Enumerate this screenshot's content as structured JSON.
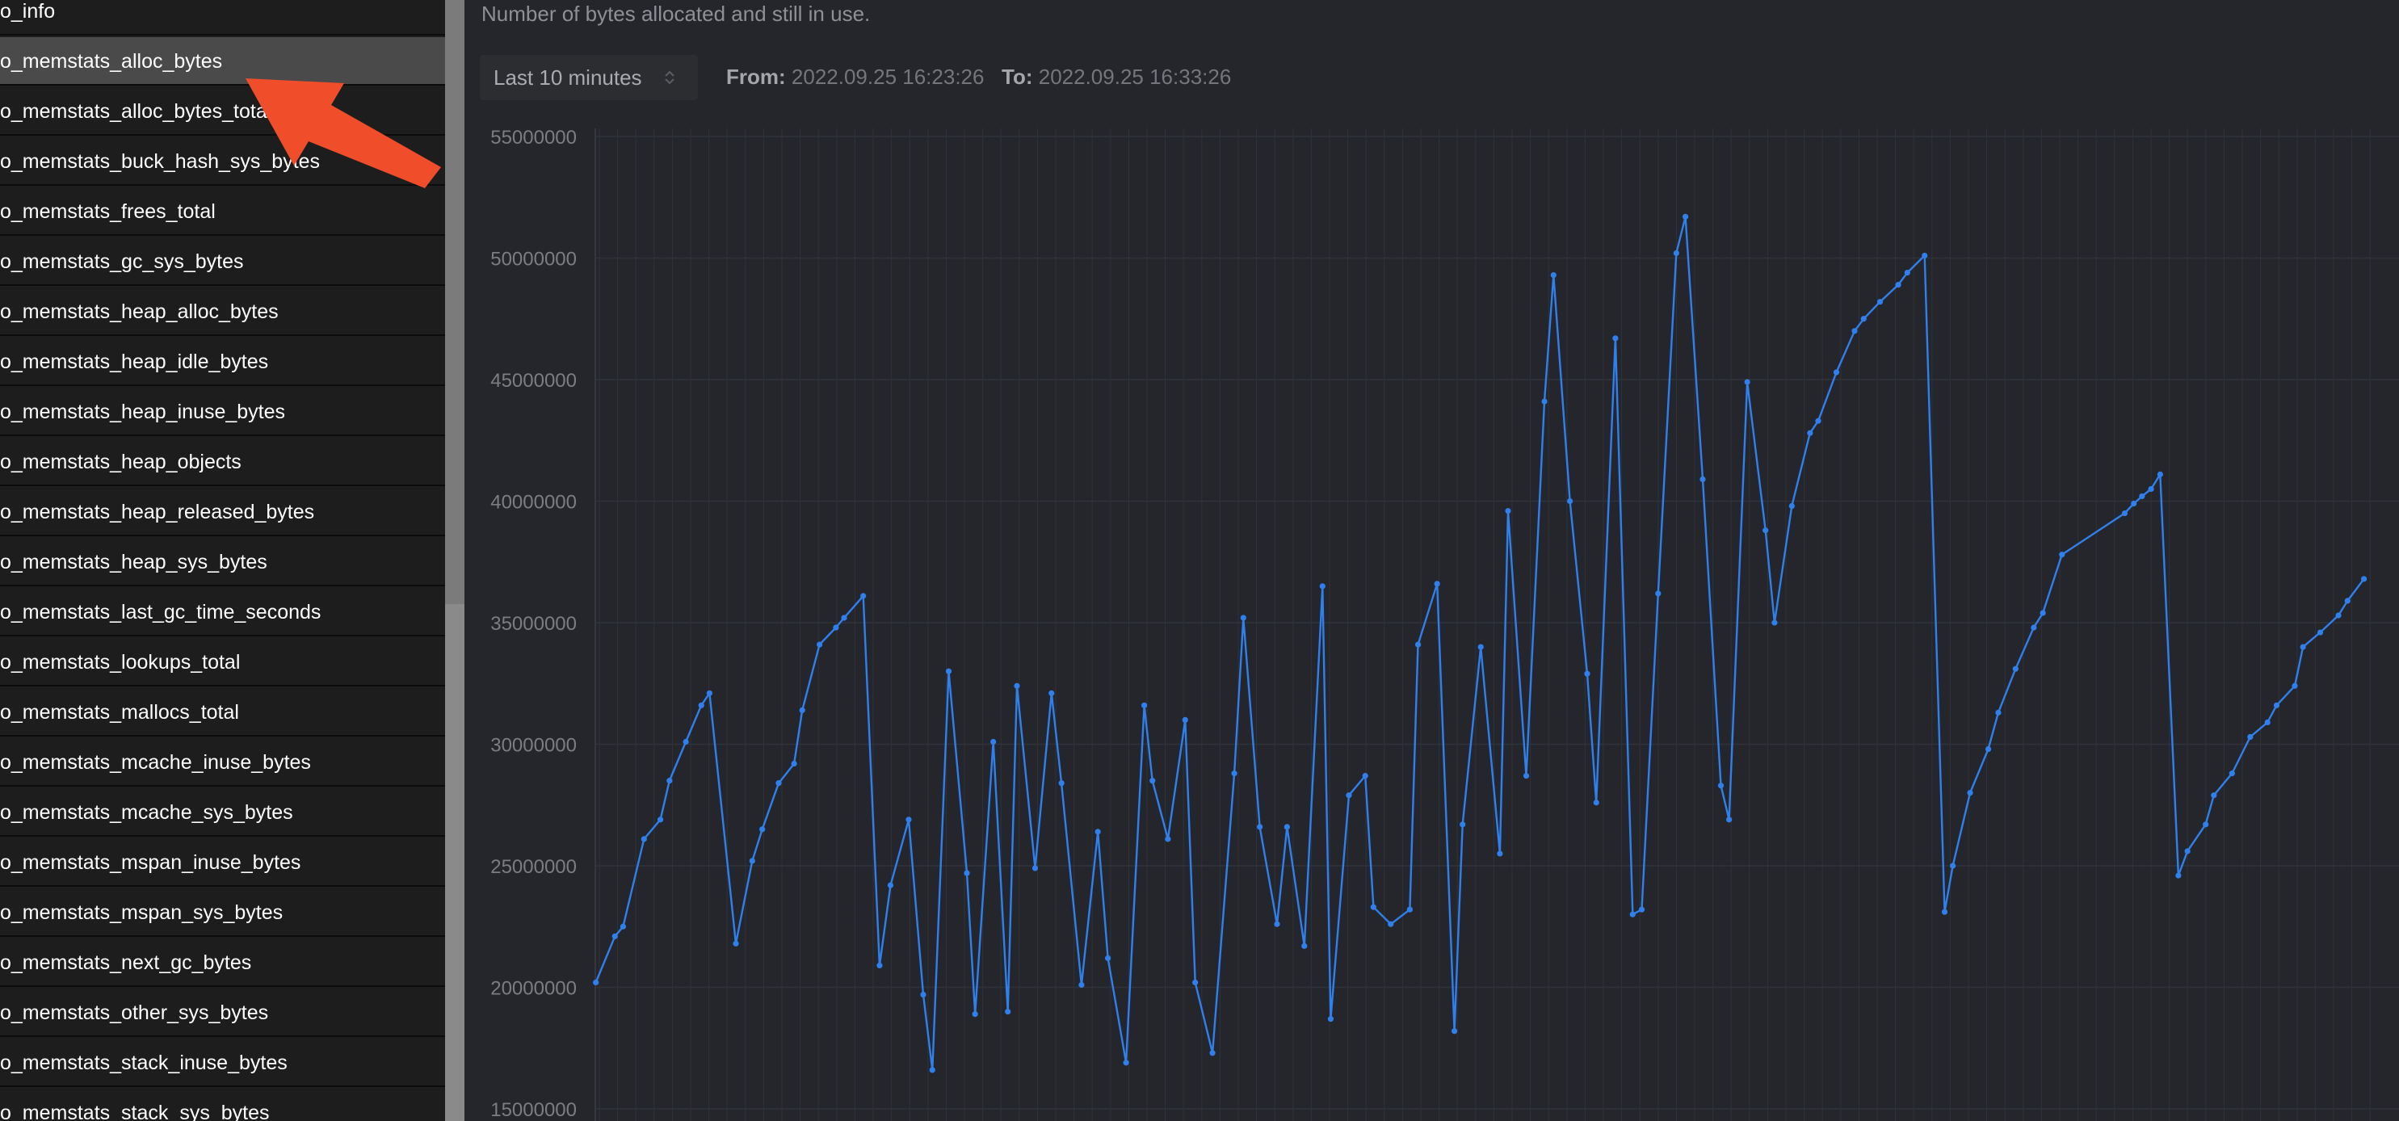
{
  "sidebar": {
    "selected_index": 1,
    "items": [
      "o_info",
      "o_memstats_alloc_bytes",
      "o_memstats_alloc_bytes_total",
      "o_memstats_buck_hash_sys_bytes",
      "o_memstats_frees_total",
      "o_memstats_gc_sys_bytes",
      "o_memstats_heap_alloc_bytes",
      "o_memstats_heap_idle_bytes",
      "o_memstats_heap_inuse_bytes",
      "o_memstats_heap_objects",
      "o_memstats_heap_released_bytes",
      "o_memstats_heap_sys_bytes",
      "o_memstats_last_gc_time_seconds",
      "o_memstats_lookups_total",
      "o_memstats_mallocs_total",
      "o_memstats_mcache_inuse_bytes",
      "o_memstats_mcache_sys_bytes",
      "o_memstats_mspan_inuse_bytes",
      "o_memstats_mspan_sys_bytes",
      "o_memstats_next_gc_bytes",
      "o_memstats_other_sys_bytes",
      "o_memstats_stack_inuse_bytes",
      "o_memstats_stack_sys_bytes"
    ]
  },
  "main": {
    "description": "Number of bytes allocated and still in use.",
    "range": {
      "selected": "Last 10 minutes"
    },
    "from": {
      "label": "From:",
      "value": "2022.09.25 16:23:26"
    },
    "to": {
      "label": "To:",
      "value": "2022.09.25 16:33:26"
    }
  },
  "colors": {
    "series": "#2f80ed",
    "annotation_arrow": "#f04e2a",
    "grid": "#30333a"
  },
  "chart_data": {
    "type": "line",
    "y_ticks": [
      "55000000",
      "50000000",
      "45000000",
      "40000000",
      "35000000",
      "30000000",
      "25000000",
      "20000000",
      "15000000"
    ],
    "ylim": [
      15000000,
      55000000
    ],
    "grid": true,
    "series": [
      {
        "color": "#2f80ed",
        "points": [
          [
            0.5,
            20200000
          ],
          [
            2.6,
            22100000
          ],
          [
            3.5,
            22500000
          ],
          [
            5.8,
            26100000
          ],
          [
            7.6,
            26900000
          ],
          [
            8.6,
            28500000
          ],
          [
            10.4,
            30100000
          ],
          [
            12.1,
            31600000
          ],
          [
            13.0,
            32100000
          ],
          [
            15.9,
            21800000
          ],
          [
            17.7,
            25200000
          ],
          [
            18.8,
            26500000
          ],
          [
            20.6,
            28400000
          ],
          [
            22.3,
            29200000
          ],
          [
            23.2,
            31400000
          ],
          [
            25.1,
            34100000
          ],
          [
            26.9,
            34800000
          ],
          [
            27.8,
            35200000
          ],
          [
            29.9,
            36100000
          ],
          [
            31.7,
            20900000
          ],
          [
            32.9,
            24200000
          ],
          [
            34.9,
            26900000
          ],
          [
            36.5,
            19700000
          ],
          [
            37.5,
            16600000
          ],
          [
            39.3,
            33000000
          ],
          [
            41.3,
            24700000
          ],
          [
            42.2,
            18900000
          ],
          [
            44.2,
            30100000
          ],
          [
            45.8,
            19000000
          ],
          [
            46.8,
            32400000
          ],
          [
            48.8,
            24900000
          ],
          [
            50.6,
            32100000
          ],
          [
            51.7,
            28400000
          ],
          [
            53.9,
            20100000
          ],
          [
            55.7,
            26400000
          ],
          [
            56.8,
            21200000
          ],
          [
            58.8,
            16900000
          ],
          [
            60.8,
            31600000
          ],
          [
            61.7,
            28500000
          ],
          [
            63.4,
            26100000
          ],
          [
            65.3,
            31000000
          ],
          [
            66.4,
            20200000
          ],
          [
            68.3,
            17300000
          ],
          [
            70.7,
            28800000
          ],
          [
            71.7,
            35200000
          ],
          [
            73.5,
            26600000
          ],
          [
            75.4,
            22600000
          ],
          [
            76.5,
            26600000
          ],
          [
            78.4,
            21700000
          ],
          [
            80.4,
            36500000
          ],
          [
            81.3,
            18700000
          ],
          [
            83.3,
            27900000
          ],
          [
            85.1,
            28700000
          ],
          [
            86.0,
            23300000
          ],
          [
            87.9,
            22600000
          ],
          [
            90.0,
            23200000
          ],
          [
            90.9,
            34100000
          ],
          [
            93.0,
            36600000
          ],
          [
            94.9,
            18200000
          ],
          [
            95.8,
            26700000
          ],
          [
            97.8,
            34000000
          ],
          [
            99.9,
            25500000
          ],
          [
            100.8,
            39600000
          ],
          [
            102.8,
            28700000
          ],
          [
            104.8,
            44100000
          ],
          [
            105.8,
            49300000
          ],
          [
            107.6,
            40000000
          ],
          [
            109.5,
            32900000
          ],
          [
            110.5,
            27600000
          ],
          [
            112.6,
            46700000
          ],
          [
            114.5,
            23000000
          ],
          [
            115.5,
            23200000
          ],
          [
            117.3,
            36200000
          ],
          [
            119.3,
            50200000
          ],
          [
            120.3,
            51700000
          ],
          [
            122.2,
            40900000
          ],
          [
            124.2,
            28300000
          ],
          [
            125.1,
            26900000
          ],
          [
            127.1,
            44900000
          ],
          [
            129.1,
            38800000
          ],
          [
            130.1,
            35000000
          ],
          [
            132.0,
            39800000
          ],
          [
            134.0,
            42800000
          ],
          [
            134.9,
            43300000
          ],
          [
            136.9,
            45300000
          ],
          [
            138.9,
            47000000
          ],
          [
            139.9,
            47500000
          ],
          [
            141.7,
            48200000
          ],
          [
            143.7,
            48900000
          ],
          [
            144.7,
            49400000
          ],
          [
            146.6,
            50100000
          ],
          [
            148.8,
            23100000
          ],
          [
            149.7,
            25000000
          ],
          [
            151.6,
            28000000
          ],
          [
            153.6,
            29800000
          ],
          [
            154.7,
            31300000
          ],
          [
            156.6,
            33100000
          ],
          [
            158.6,
            34800000
          ],
          [
            159.6,
            35400000
          ],
          [
            161.7,
            37800000
          ],
          [
            168.6,
            39500000
          ],
          [
            169.6,
            39900000
          ],
          [
            170.5,
            40200000
          ],
          [
            171.5,
            40500000
          ],
          [
            172.5,
            41100000
          ],
          [
            174.5,
            24600000
          ],
          [
            175.5,
            25600000
          ],
          [
            177.5,
            26700000
          ],
          [
            178.4,
            27900000
          ],
          [
            180.4,
            28800000
          ],
          [
            182.4,
            30300000
          ],
          [
            184.3,
            30900000
          ],
          [
            185.3,
            31600000
          ],
          [
            187.3,
            32400000
          ],
          [
            188.2,
            34000000
          ],
          [
            190.1,
            34600000
          ],
          [
            192.1,
            35300000
          ],
          [
            193.1,
            35900000
          ],
          [
            194.9,
            36800000
          ]
        ]
      }
    ]
  }
}
